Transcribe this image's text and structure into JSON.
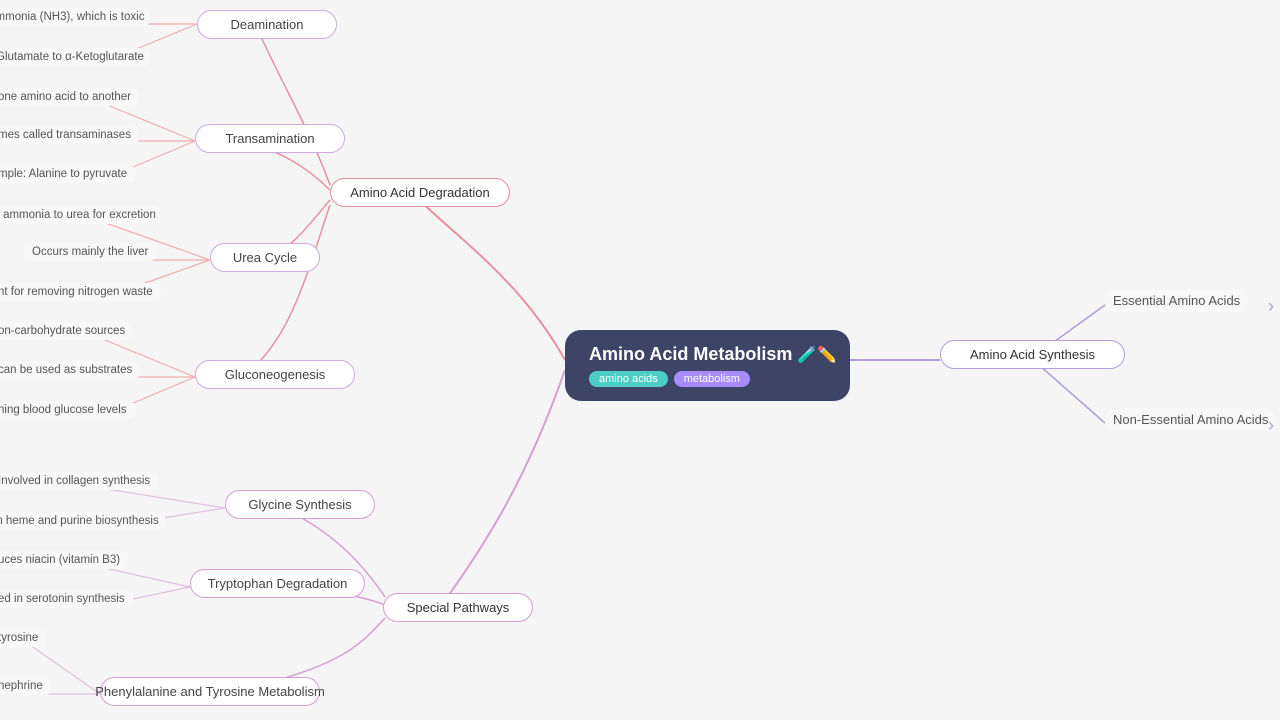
{
  "center": {
    "title": "Amino Acid Metabolism",
    "tags": [
      "amino acids",
      "metabolism"
    ],
    "icon": "🧪✏️"
  },
  "branches": {
    "degradation": {
      "label": "Amino Acid Degradation",
      "children": {
        "deamination": {
          "label": "Deamination",
          "leaves": [
            "mmonia (NH3), which is toxic",
            "Glutamate to α-Ketoglutarate"
          ]
        },
        "transamination": {
          "label": "Transamination",
          "leaves": [
            "one amino acid to another",
            "mes called transaminases",
            "mple: Alanine to pyruvate"
          ]
        },
        "urea": {
          "label": "Urea Cycle",
          "leaves": [
            "s ammonia to urea for excretion",
            "Occurs mainly the liver",
            "nt for removing nitrogen waste"
          ]
        },
        "gluco": {
          "label": "Gluconeogenesis",
          "leaves": [
            "on-carbohydrate sources",
            "can be used as substrates",
            "ning blood glucose levels"
          ]
        }
      }
    },
    "special": {
      "label": "Special Pathways",
      "children": {
        "glycine": {
          "label": "Glycine Synthesis",
          "leaves": [
            "Involved in collagen synthesis",
            "n heme and purine biosynthesis"
          ]
        },
        "tryptophan": {
          "label": "Tryptophan Degradation",
          "leaves": [
            "uces niacin (vitamin B3)",
            "ed in serotonin synthesis"
          ]
        },
        "phenyl": {
          "label": "Phenylalanine and Tyrosine Metabolism",
          "leaves": [
            "tyrosine",
            "nephrine"
          ]
        }
      }
    },
    "synthesis": {
      "label": "Amino Acid Synthesis",
      "children": {
        "essential": "Essential Amino Acids",
        "nonessential": "Non-Essential Amino Acids"
      }
    }
  }
}
